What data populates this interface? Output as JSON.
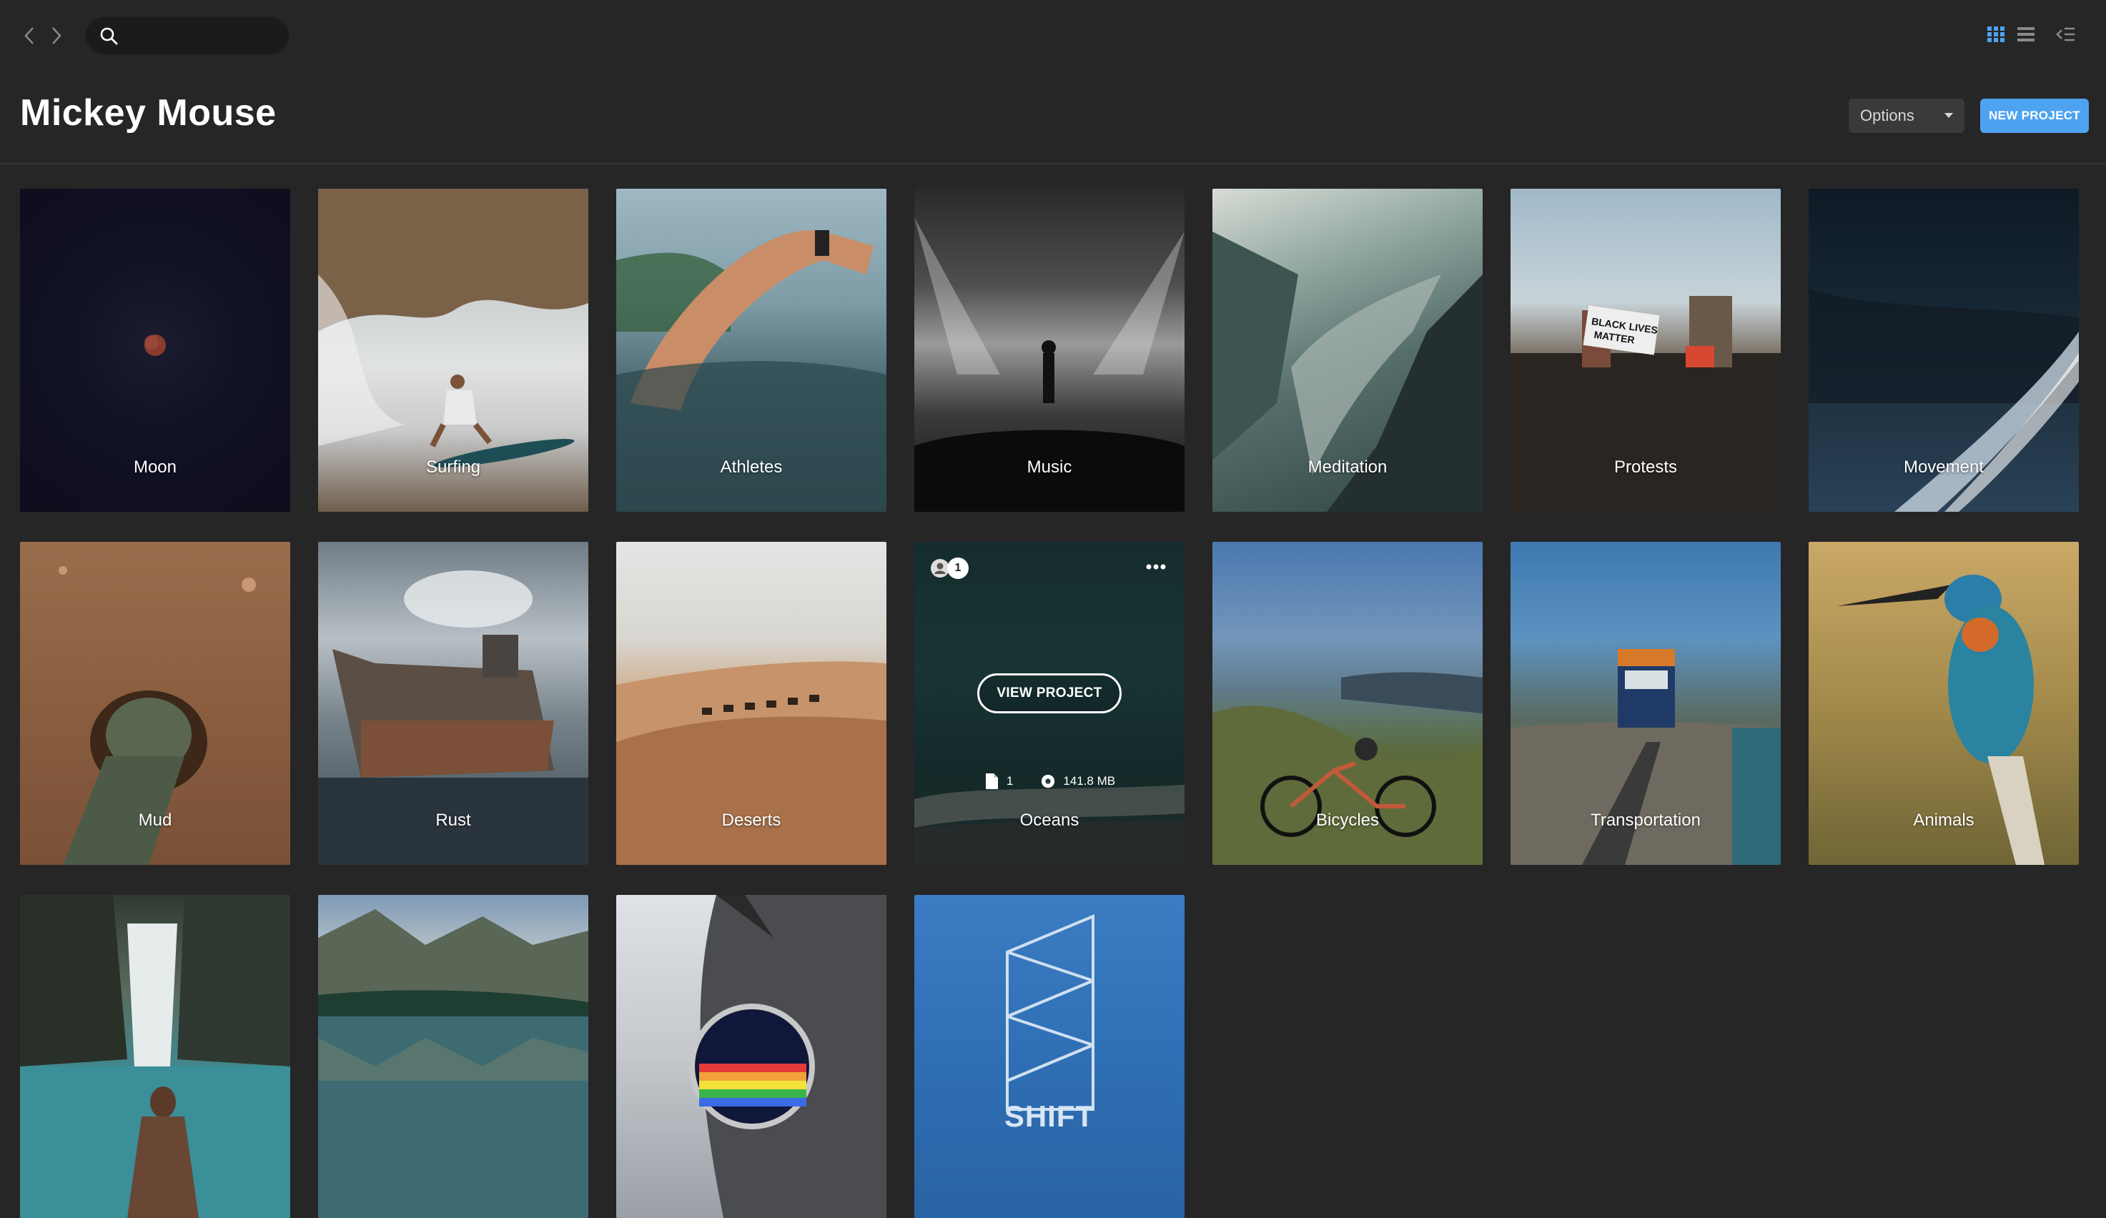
{
  "search": {
    "placeholder": "",
    "value": ""
  },
  "header": {
    "title": "Mickey Mouse"
  },
  "toolbar": {
    "options_label": "Options",
    "new_project_label": "NEW PROJECT"
  },
  "view_modes": [
    "grid-view",
    "list-view",
    "collapse-panel"
  ],
  "colors": {
    "background": "#262626",
    "accent": "#4ea3f1",
    "search_bg": "#1b1b1b",
    "options_bg": "#3a3a3a"
  },
  "projects": [
    {
      "label": "Moon"
    },
    {
      "label": "Surfing"
    },
    {
      "label": "Athletes"
    },
    {
      "label": "Music"
    },
    {
      "label": "Meditation"
    },
    {
      "label": "Protests"
    },
    {
      "label": "Movement"
    },
    {
      "label": "Mud"
    },
    {
      "label": "Rust"
    },
    {
      "label": "Deserts"
    },
    {
      "label": "Oceans",
      "members": "1",
      "file_count": "1",
      "size": "141.8 MB",
      "action_label": "VIEW PROJECT"
    },
    {
      "label": "Bicycles"
    },
    {
      "label": "Transportation"
    },
    {
      "label": "Animals"
    },
    {
      "label": ""
    },
    {
      "label": ""
    },
    {
      "label": ""
    },
    {
      "label": "",
      "logo_text": "SHIFT"
    }
  ]
}
